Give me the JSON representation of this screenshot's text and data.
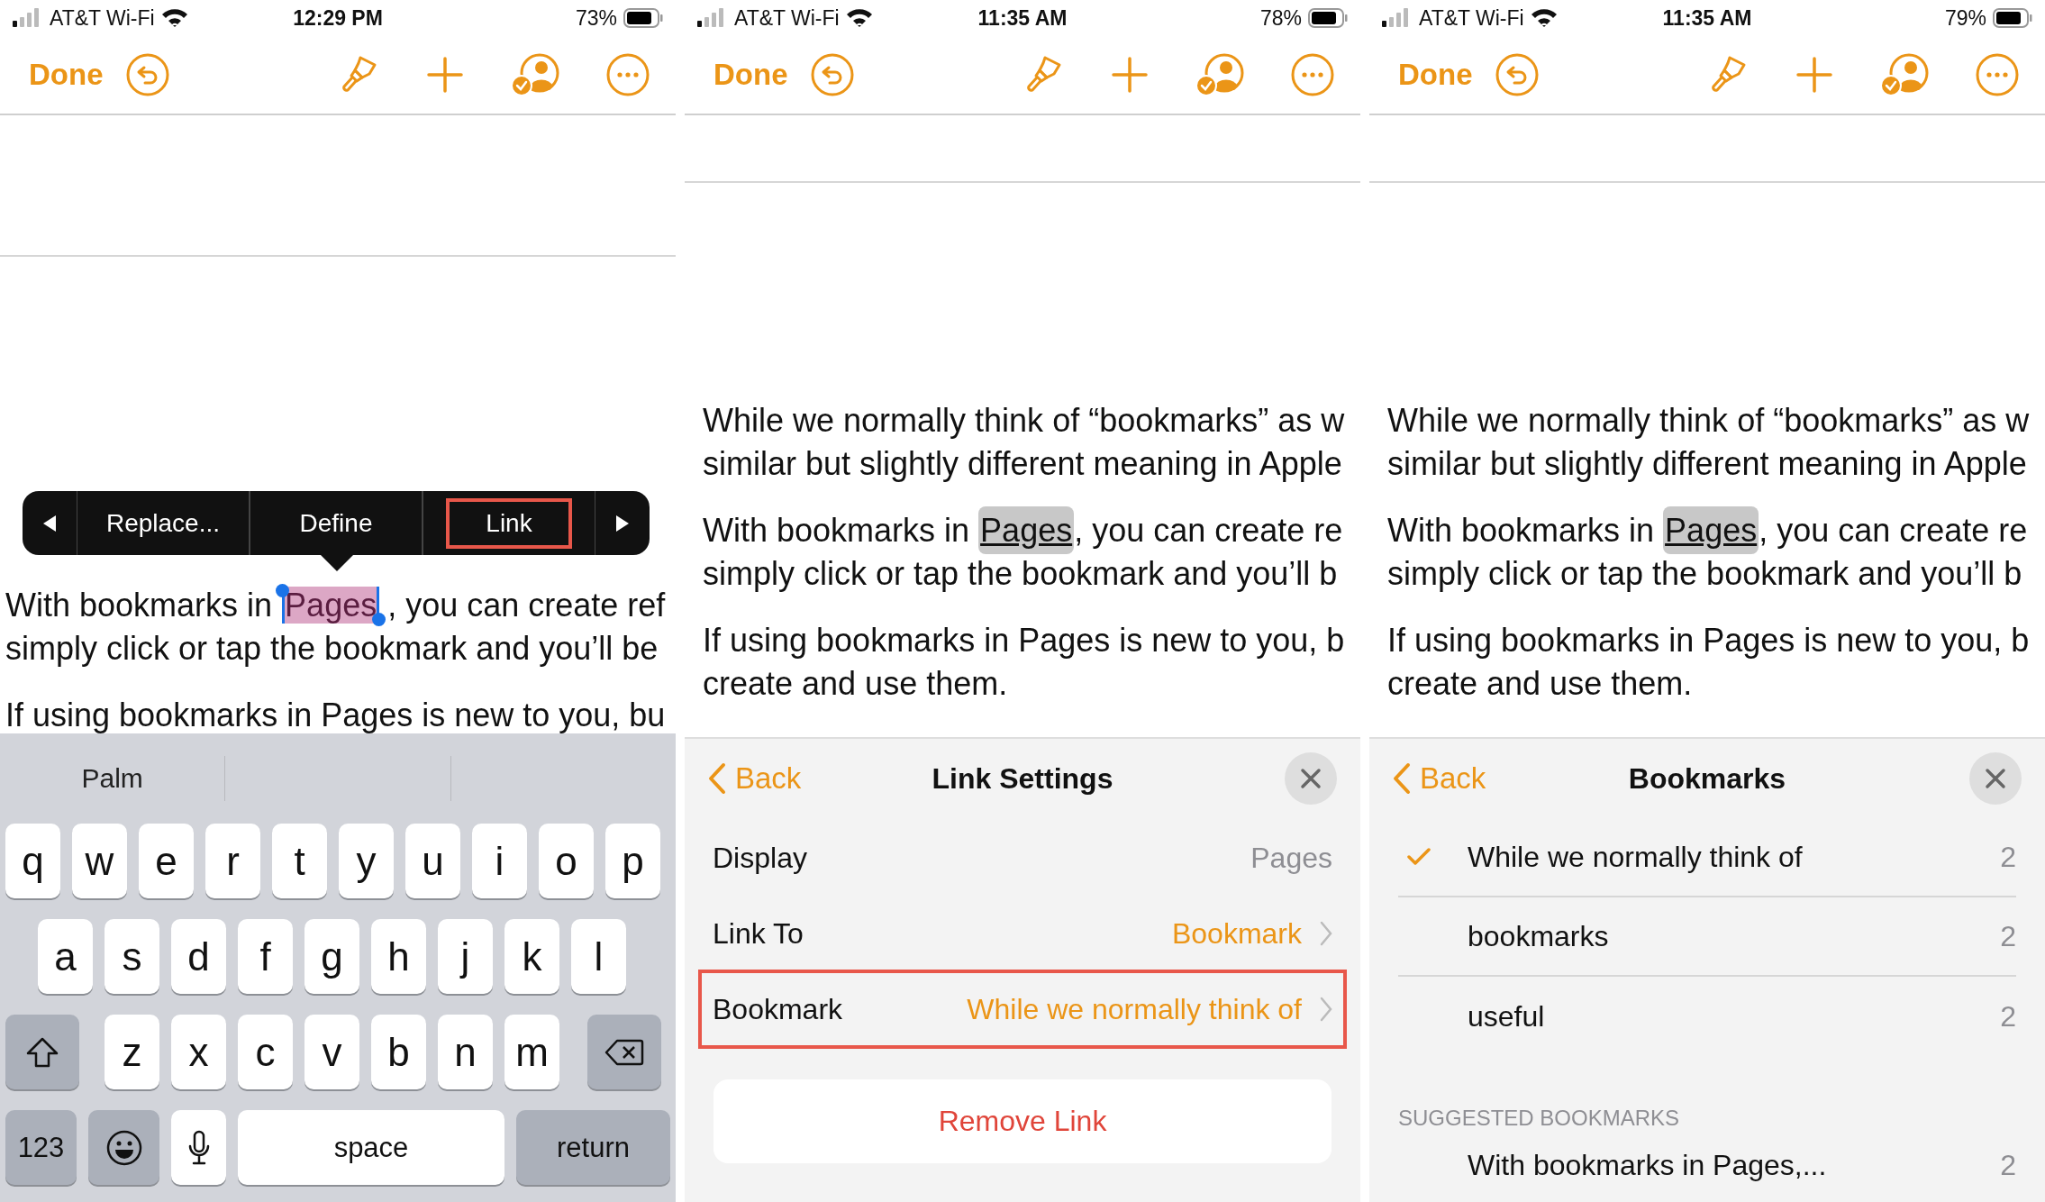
{
  "panels": [
    {
      "kind": "editing",
      "status_bar": {
        "carrier": "AT&T Wi-Fi",
        "time": "12:29 PM",
        "battery": "73%"
      },
      "toolbar": {
        "done": "Done"
      },
      "document": {
        "paragraphs": [
          [
            [
              {
                "text": "With bookmarks in ",
                "kind": "plain"
              },
              {
                "text": "Pages",
                "kind": "selected"
              },
              {
                "text": ", you can create ref",
                "kind": "plain"
              }
            ],
            [
              {
                "text": "simply click or tap the bookmark and you’ll be",
                "kind": "plain"
              }
            ]
          ],
          [
            [
              {
                "text": "If using bookmarks in Pages is new to you, bu",
                "kind": "plain"
              }
            ]
          ]
        ]
      },
      "edit_menu": {
        "items": [
          {
            "label": "Replace...",
            "highlighted": false
          },
          {
            "label": "Define",
            "highlighted": false
          },
          {
            "label": "Link",
            "highlighted": true
          }
        ]
      },
      "keyboard": {
        "suggestions": [
          "Palm"
        ],
        "rows": [
          {
            "keys": [
              {
                "kind": "letter",
                "label": "q"
              },
              {
                "kind": "letter",
                "label": "w"
              },
              {
                "kind": "letter",
                "label": "e"
              },
              {
                "kind": "letter",
                "label": "r"
              },
              {
                "kind": "letter",
                "label": "t"
              },
              {
                "kind": "letter",
                "label": "y"
              },
              {
                "kind": "letter",
                "label": "u"
              },
              {
                "kind": "letter",
                "label": "i"
              },
              {
                "kind": "letter",
                "label": "o"
              },
              {
                "kind": "letter",
                "label": "p"
              }
            ]
          },
          {
            "keys": [
              {
                "kind": "letter",
                "label": "a"
              },
              {
                "kind": "letter",
                "label": "s"
              },
              {
                "kind": "letter",
                "label": "d"
              },
              {
                "kind": "letter",
                "label": "f"
              },
              {
                "kind": "letter",
                "label": "g"
              },
              {
                "kind": "letter",
                "label": "h"
              },
              {
                "kind": "letter",
                "label": "j"
              },
              {
                "kind": "letter",
                "label": "k"
              },
              {
                "kind": "letter",
                "label": "l"
              }
            ]
          },
          {
            "keys": [
              {
                "kind": "shift"
              },
              {
                "kind": "letter",
                "label": "z"
              },
              {
                "kind": "letter",
                "label": "x"
              },
              {
                "kind": "letter",
                "label": "c"
              },
              {
                "kind": "letter",
                "label": "v"
              },
              {
                "kind": "letter",
                "label": "b"
              },
              {
                "kind": "letter",
                "label": "n"
              },
              {
                "kind": "letter",
                "label": "m"
              },
              {
                "kind": "delete"
              }
            ]
          },
          {
            "keys": [
              {
                "kind": "numbers",
                "label": "123"
              },
              {
                "kind": "emoji"
              },
              {
                "kind": "dictation"
              },
              {
                "kind": "space",
                "label": "space"
              },
              {
                "kind": "return",
                "label": "return"
              }
            ]
          }
        ]
      }
    },
    {
      "kind": "link-settings",
      "status_bar": {
        "carrier": "AT&T Wi-Fi",
        "time": "11:35 AM",
        "battery": "78%"
      },
      "toolbar": {
        "done": "Done"
      },
      "document": {
        "paragraphs": [
          [
            [
              {
                "text": "While we normally think of “bookmarks” as w",
                "kind": "plain"
              }
            ],
            [
              {
                "text": "similar but slightly different meaning in Apple",
                "kind": "plain"
              }
            ]
          ],
          [
            [
              {
                "text": "With bookmarks in ",
                "kind": "plain"
              },
              {
                "text": "Pages",
                "kind": "link"
              },
              {
                "text": ", you can create re",
                "kind": "plain"
              }
            ],
            [
              {
                "text": "simply click or tap the bookmark and you’ll b",
                "kind": "plain"
              }
            ]
          ],
          [
            [
              {
                "text": "If using bookmarks in Pages is new to you, b",
                "kind": "plain"
              }
            ],
            [
              {
                "text": "create and use them.",
                "kind": "plain"
              }
            ]
          ]
        ]
      },
      "sheet": {
        "back": "Back",
        "title": "Link Settings",
        "rows": [
          {
            "label": "Display",
            "value": "Pages",
            "kind": "info",
            "highlighted": false
          },
          {
            "label": "Link To",
            "value": "Bookmark",
            "kind": "choice",
            "highlighted": false
          },
          {
            "label": "Bookmark",
            "value": "While we normally think of",
            "kind": "choice",
            "highlighted": true
          }
        ],
        "action": "Remove Link"
      }
    },
    {
      "kind": "bookmarks",
      "status_bar": {
        "carrier": "AT&T Wi-Fi",
        "time": "11:35 AM",
        "battery": "79%"
      },
      "toolbar": {
        "done": "Done"
      },
      "document": {
        "paragraphs": [
          [
            [
              {
                "text": "While we normally think of “bookmarks” as w",
                "kind": "plain"
              }
            ],
            [
              {
                "text": "similar but slightly different meaning in Apple",
                "kind": "plain"
              }
            ]
          ],
          [
            [
              {
                "text": "With bookmarks in ",
                "kind": "plain"
              },
              {
                "text": "Pages",
                "kind": "link"
              },
              {
                "text": ", you can create re",
                "kind": "plain"
              }
            ],
            [
              {
                "text": "simply click or tap the bookmark and you’ll b",
                "kind": "plain"
              }
            ]
          ],
          [
            [
              {
                "text": "If using bookmarks in Pages is new to you, b",
                "kind": "plain"
              }
            ],
            [
              {
                "text": "create and use them.",
                "kind": "plain"
              }
            ]
          ]
        ]
      },
      "sheet": {
        "back": "Back",
        "title": "Bookmarks",
        "bookmarks": [
          {
            "name": "While we normally think of",
            "count": "2",
            "selected": true
          },
          {
            "name": "bookmarks",
            "count": "2",
            "selected": false
          },
          {
            "name": "useful",
            "count": "2",
            "selected": false
          }
        ],
        "section_title": "SUGGESTED BOOKMARKS",
        "suggested": [
          {
            "name": "With bookmarks in Pages,...",
            "count": "2",
            "selected": false
          }
        ]
      }
    }
  ]
}
